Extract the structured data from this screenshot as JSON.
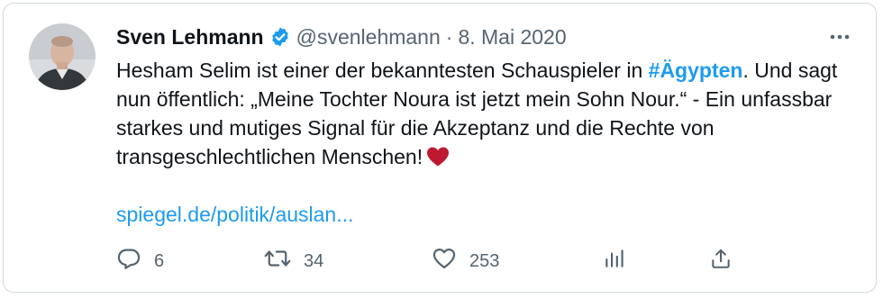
{
  "author": {
    "name": "Sven Lehmann",
    "handle": "@svenlehmann",
    "separator": "·",
    "date": "8. Mai 2020",
    "verified": true
  },
  "tweet": {
    "text_part1": "Hesham Selim ist einer der bekanntesten Schauspieler in ",
    "hashtag": "#Ägypten",
    "text_part2": ". Und sagt nun öffentlich: „Meine Tochter Noura ist jetzt mein Sohn Nour.“ - Ein unfassbar starkes und mutiges Signal für die Akzeptanz und die Rechte von transgeschlechtlichen Menschen!",
    "emoji": "red-heart",
    "link_text": "spiegel.de/politik/auslan..."
  },
  "actions": {
    "replies": "6",
    "retweets": "34",
    "likes": "253"
  },
  "icons": {
    "more": "more-horizontal-icon",
    "reply": "reply-icon",
    "retweet": "retweet-icon",
    "like": "heart-icon",
    "views": "views-icon",
    "share": "share-icon",
    "verified": "verified-badge-icon"
  },
  "colors": {
    "link": "#1d9bf0",
    "secondary_text": "#536471",
    "border": "#cfd9de",
    "heart": "#be1931"
  }
}
